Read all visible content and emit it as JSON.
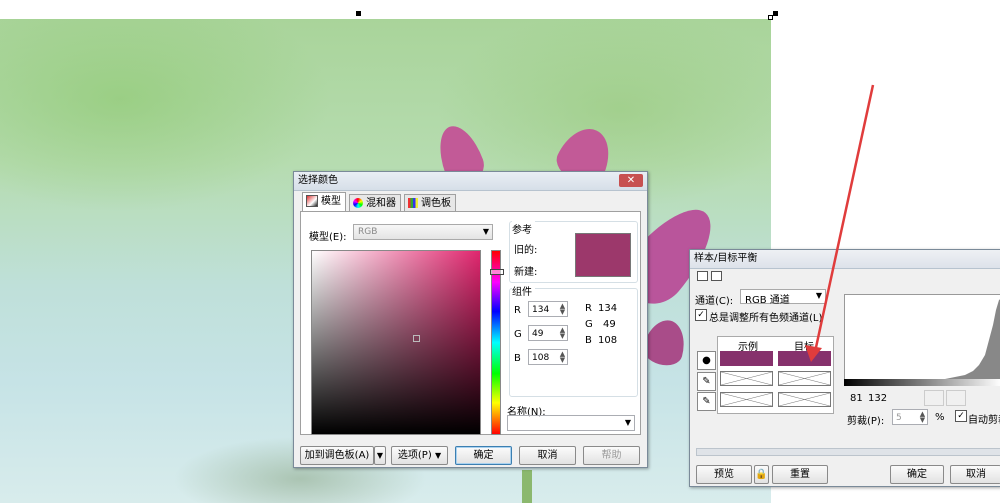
{
  "color_dialog": {
    "title": "选择颜色",
    "tabs": [
      {
        "label": "模型",
        "icon": "model-icon"
      },
      {
        "label": "混和器",
        "icon": "mixer-icon"
      },
      {
        "label": "调色板",
        "icon": "palette-icon"
      }
    ],
    "model_label": "模型(E):",
    "model_value": "RGB",
    "reference_title": "参考",
    "old_label": "旧的:",
    "new_label": "新建:",
    "old_color": "#9c386b",
    "components_title": "组件",
    "components": [
      {
        "name": "R",
        "value": "134",
        "readout": "134"
      },
      {
        "name": "G",
        "value": "49",
        "readout": "49"
      },
      {
        "name": "B",
        "value": "108",
        "readout": "108"
      }
    ],
    "name_label": "名称(N):",
    "buttons": {
      "add_palette": "加到调色板(A)",
      "options": "选项(P)",
      "ok": "确定",
      "cancel": "取消",
      "help": "帮助"
    }
  },
  "balance_dialog": {
    "title": "样本/目标平衡",
    "channel_label": "通道(C):",
    "channel_value": "RGB 通道",
    "always_adjust_label": "总是调整所有色频通道(L)",
    "always_adjust_checked": true,
    "sample_header": "示例",
    "target_header": "目标",
    "swatch_color": "#86316c",
    "histogram_low": "81",
    "histogram_high": "132",
    "clip_label": "剪裁(P):",
    "clip_value": "5",
    "clip_unit": "%",
    "auto_clip_label": "自动剪裁",
    "auto_clip_checked": true,
    "buttons": {
      "preview": "预览",
      "reset": "重置",
      "ok": "确定",
      "cancel": "取消"
    }
  },
  "accent_colors": {
    "selection": "#86316c",
    "arrow": "#e03c3c"
  }
}
